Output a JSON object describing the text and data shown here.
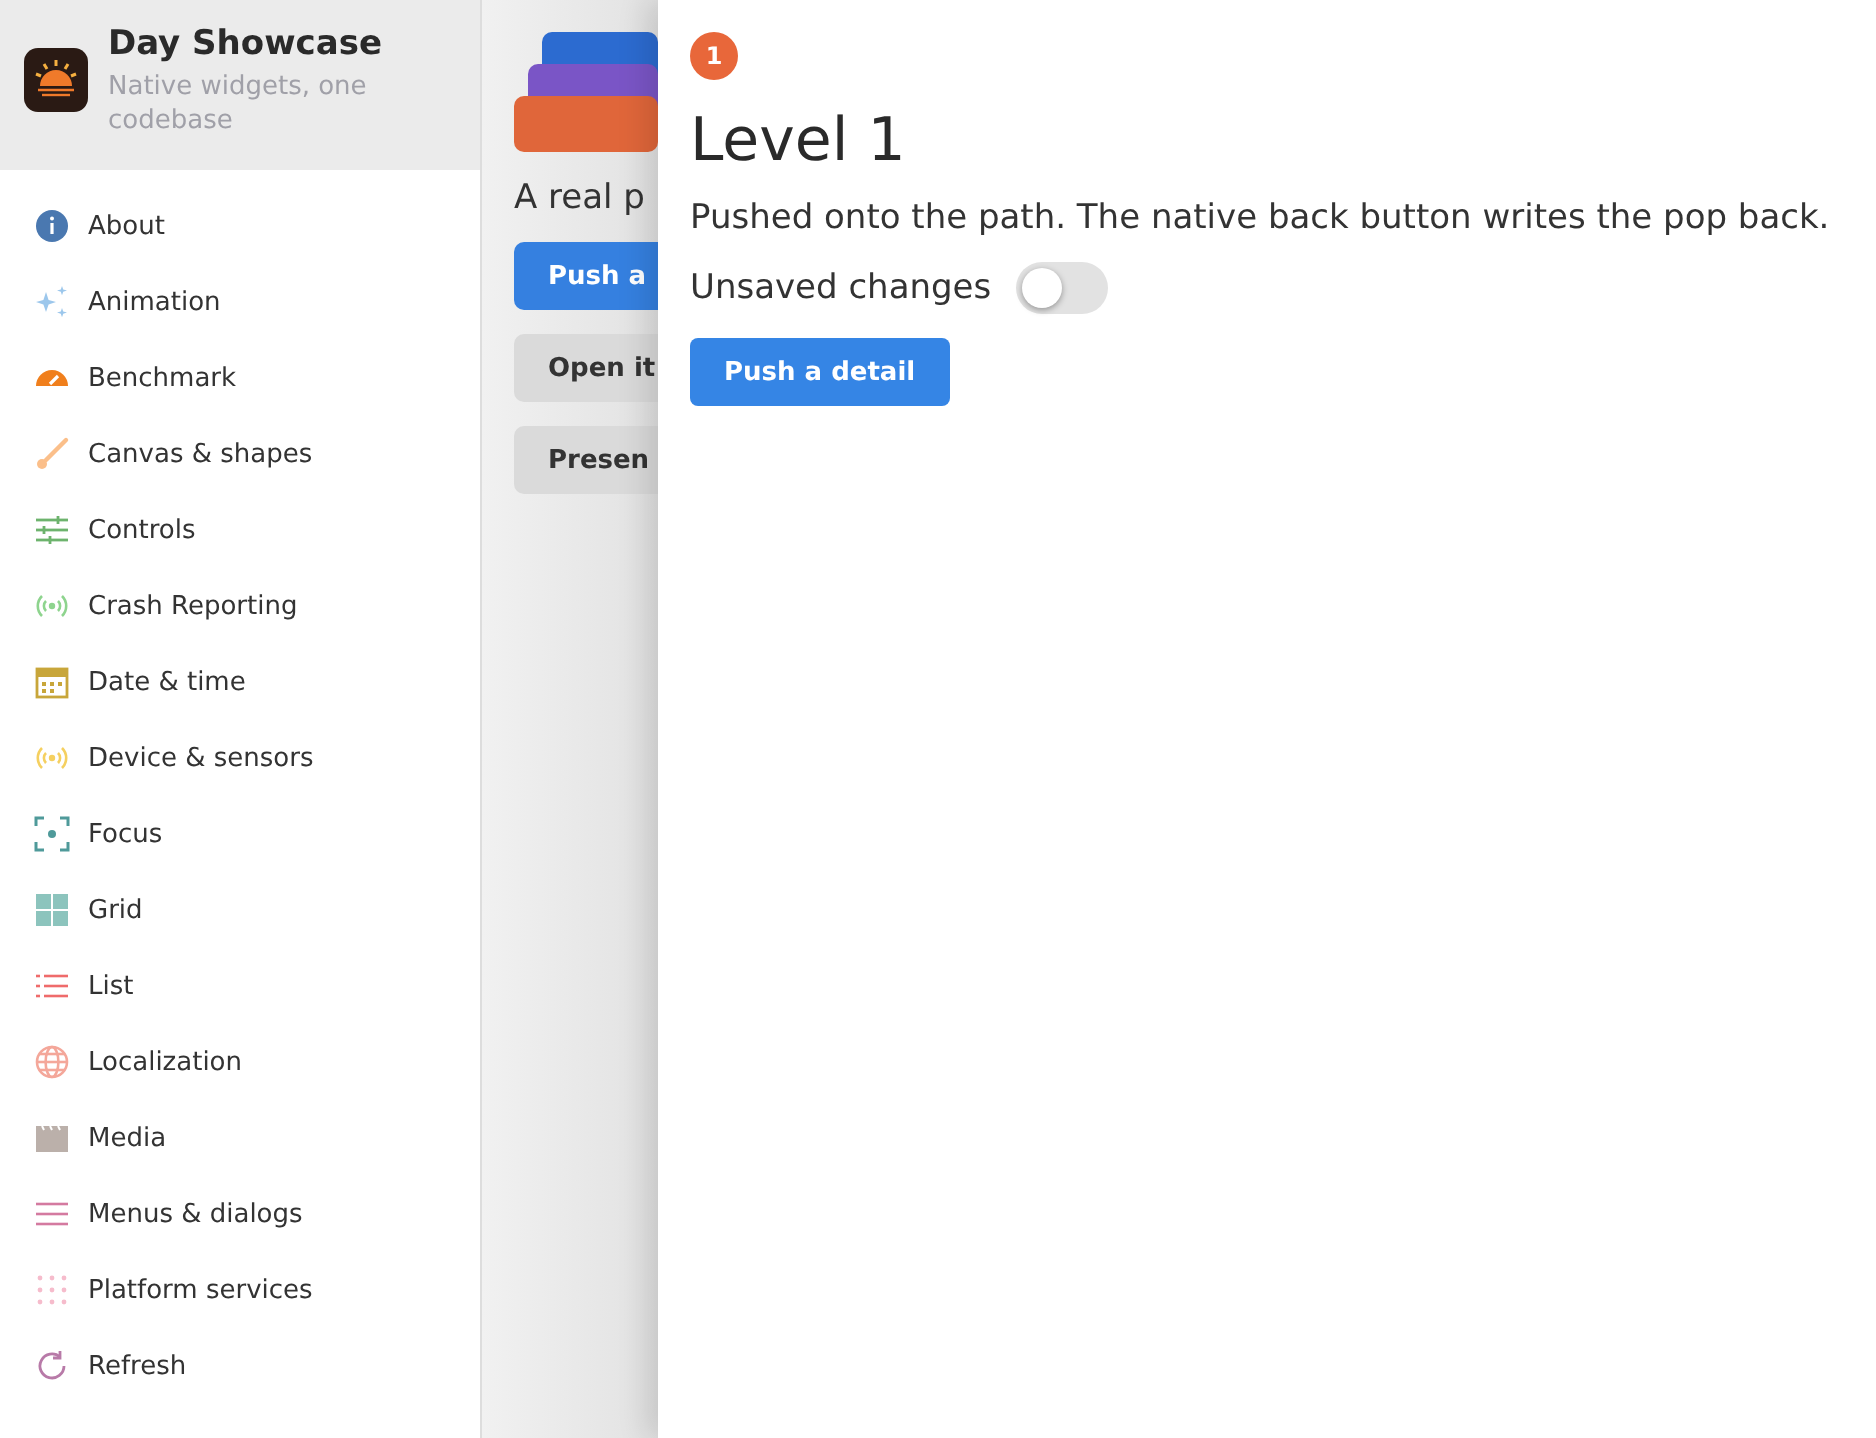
{
  "app": {
    "title": "Day Showcase",
    "subtitle": "Native widgets, one codebase"
  },
  "sidebar": {
    "items": [
      {
        "label": "About",
        "selected": false
      },
      {
        "label": "Animation",
        "selected": false
      },
      {
        "label": "Benchmark",
        "selected": false
      },
      {
        "label": "Canvas & shapes",
        "selected": false
      },
      {
        "label": "Controls",
        "selected": false
      },
      {
        "label": "Crash Reporting",
        "selected": false
      },
      {
        "label": "Date & time",
        "selected": false
      },
      {
        "label": "Device & sensors",
        "selected": false
      },
      {
        "label": "Focus",
        "selected": false
      },
      {
        "label": "Grid",
        "selected": false
      },
      {
        "label": "List",
        "selected": false
      },
      {
        "label": "Localization",
        "selected": false
      },
      {
        "label": "Media",
        "selected": false
      },
      {
        "label": "Menus & dialogs",
        "selected": false
      },
      {
        "label": "Platform services",
        "selected": false
      },
      {
        "label": "Refresh",
        "selected": false
      }
    ]
  },
  "background_page": {
    "intro": "A real p",
    "buttons": [
      {
        "label": "Push a",
        "kind": "primary"
      },
      {
        "label": "Open it",
        "kind": "secondary"
      },
      {
        "label": "Presen",
        "kind": "secondary"
      }
    ]
  },
  "detail": {
    "badge": "1",
    "title": "Level 1",
    "description": "Pushed onto the path. The native back button writes the pop back.",
    "toggle": {
      "label": "Unsaved changes",
      "on": false
    },
    "button": "Push a detail"
  }
}
